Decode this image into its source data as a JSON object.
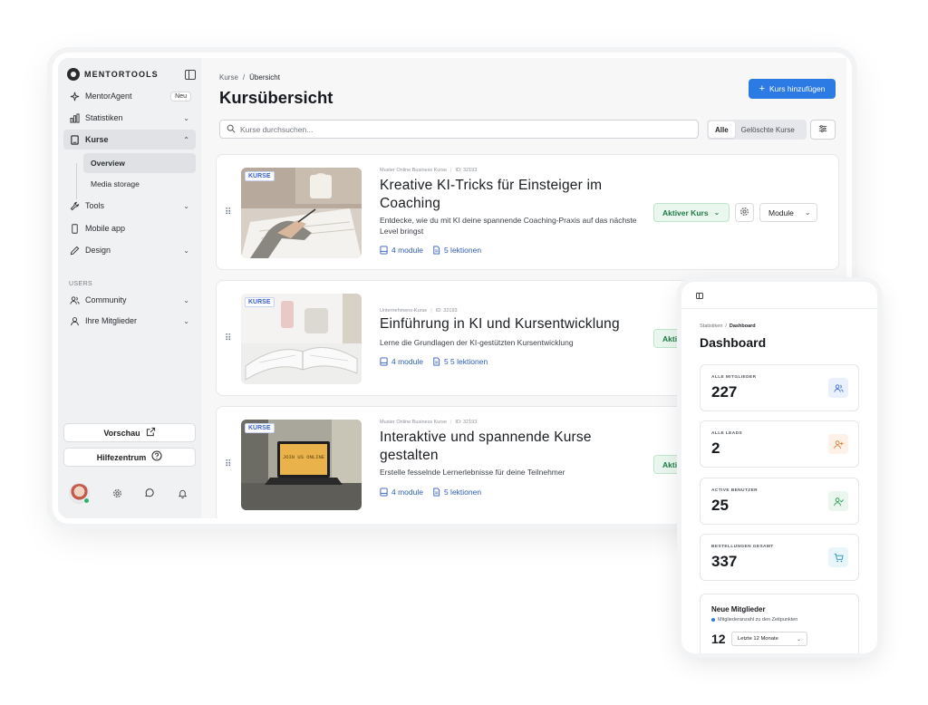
{
  "sidebar": {
    "logo": "MENTORTOOLS",
    "items": [
      {
        "label": "MentorAgent",
        "badge": "Neu"
      },
      {
        "label": "Statistiken"
      },
      {
        "label": "Kurse"
      },
      {
        "label": "Tools"
      },
      {
        "label": "Mobile app"
      },
      {
        "label": "Design"
      }
    ],
    "sub_items": [
      {
        "label": "Overview"
      },
      {
        "label": "Media storage"
      }
    ],
    "section_users": "USERS",
    "user_items": [
      {
        "label": "Community"
      },
      {
        "label": "Ihre Mitglieder"
      }
    ],
    "preview_button": "Vorschau",
    "help_button": "Hilfezentrum"
  },
  "main": {
    "breadcrumb": {
      "root": "Kurse",
      "separator": "/",
      "current": "Übersicht"
    },
    "title": "Kursübersicht",
    "add_button": "Kurs hinzufügen",
    "search": {
      "placeholder": "Kurse durchsuchen...",
      "value": ""
    },
    "filter_tabs": [
      "Alle",
      "Gelöschte Kurse"
    ],
    "active_filter": "Alle"
  },
  "courses": [
    {
      "tag": "KURSE",
      "category": "Muster Online Business Kurse",
      "id": "ID: 32193",
      "title": "Kreative KI-Tricks für Einsteiger im Coaching",
      "description": "Entdecke, wie du mit KI deine spannende Coaching-Praxis auf das nächste Level bringst",
      "modules": "4 module",
      "lessons": "5 lektionen",
      "status": "Aktiver Kurs",
      "module_button": "Module"
    },
    {
      "tag": "KURSE",
      "category": "Unternehmens-Kurse",
      "id": "ID: 32193",
      "title": "Einführung in KI und Kursentwicklung",
      "description": "Lerne die Grundlagen der KI-gestützten Kursentwicklung",
      "modules": "4 module",
      "lessons": "5 5 lektionen",
      "status": "Aktiver Kurs"
    },
    {
      "tag": "KURSE",
      "category": "Muster Online Business Kurse",
      "id": "ID: 32193",
      "title": "Interaktive und spannende Kurse gestalten",
      "description": "Erstelle fesselnde Lernerlebnisse für deine Teilnehmer",
      "modules": "4 module",
      "lessons": "5 lektionen",
      "status": "Aktiver Kurs",
      "laptop_screen_text": "JOIN US ONLINE"
    }
  ],
  "mobile": {
    "breadcrumb": {
      "root": "Statistiken",
      "separator": "/",
      "current": "Dashboard"
    },
    "title": "Dashboard",
    "stats": [
      {
        "label": "ALLE MITGLIEDER",
        "value": "227",
        "icon": "users-icon",
        "color": "#3b6fd8",
        "bg": "#eaf1fd"
      },
      {
        "label": "ALLE LEADS",
        "value": "2",
        "icon": "user-plus-icon",
        "color": "#e0803a",
        "bg": "#fdf1e8"
      },
      {
        "label": "ACTIVE BENUTZER",
        "value": "25",
        "icon": "user-check-icon",
        "color": "#2f9e5c",
        "bg": "#eaf6ee"
      },
      {
        "label": "BESTELLUNGEN GESAMT",
        "value": "337",
        "icon": "cart-icon",
        "color": "#2b93b8",
        "bg": "#e8f5fa"
      }
    ],
    "new_members": {
      "title": "Neue Mitglieder",
      "subtitle": "Mitgliederanzahl zu den Zeitpunkten",
      "value": "12",
      "range": "Letzte 12 Monate"
    }
  },
  "colors": {
    "primary": "#2c7be5",
    "success": "#1d7c45",
    "link": "#2f5db7"
  }
}
